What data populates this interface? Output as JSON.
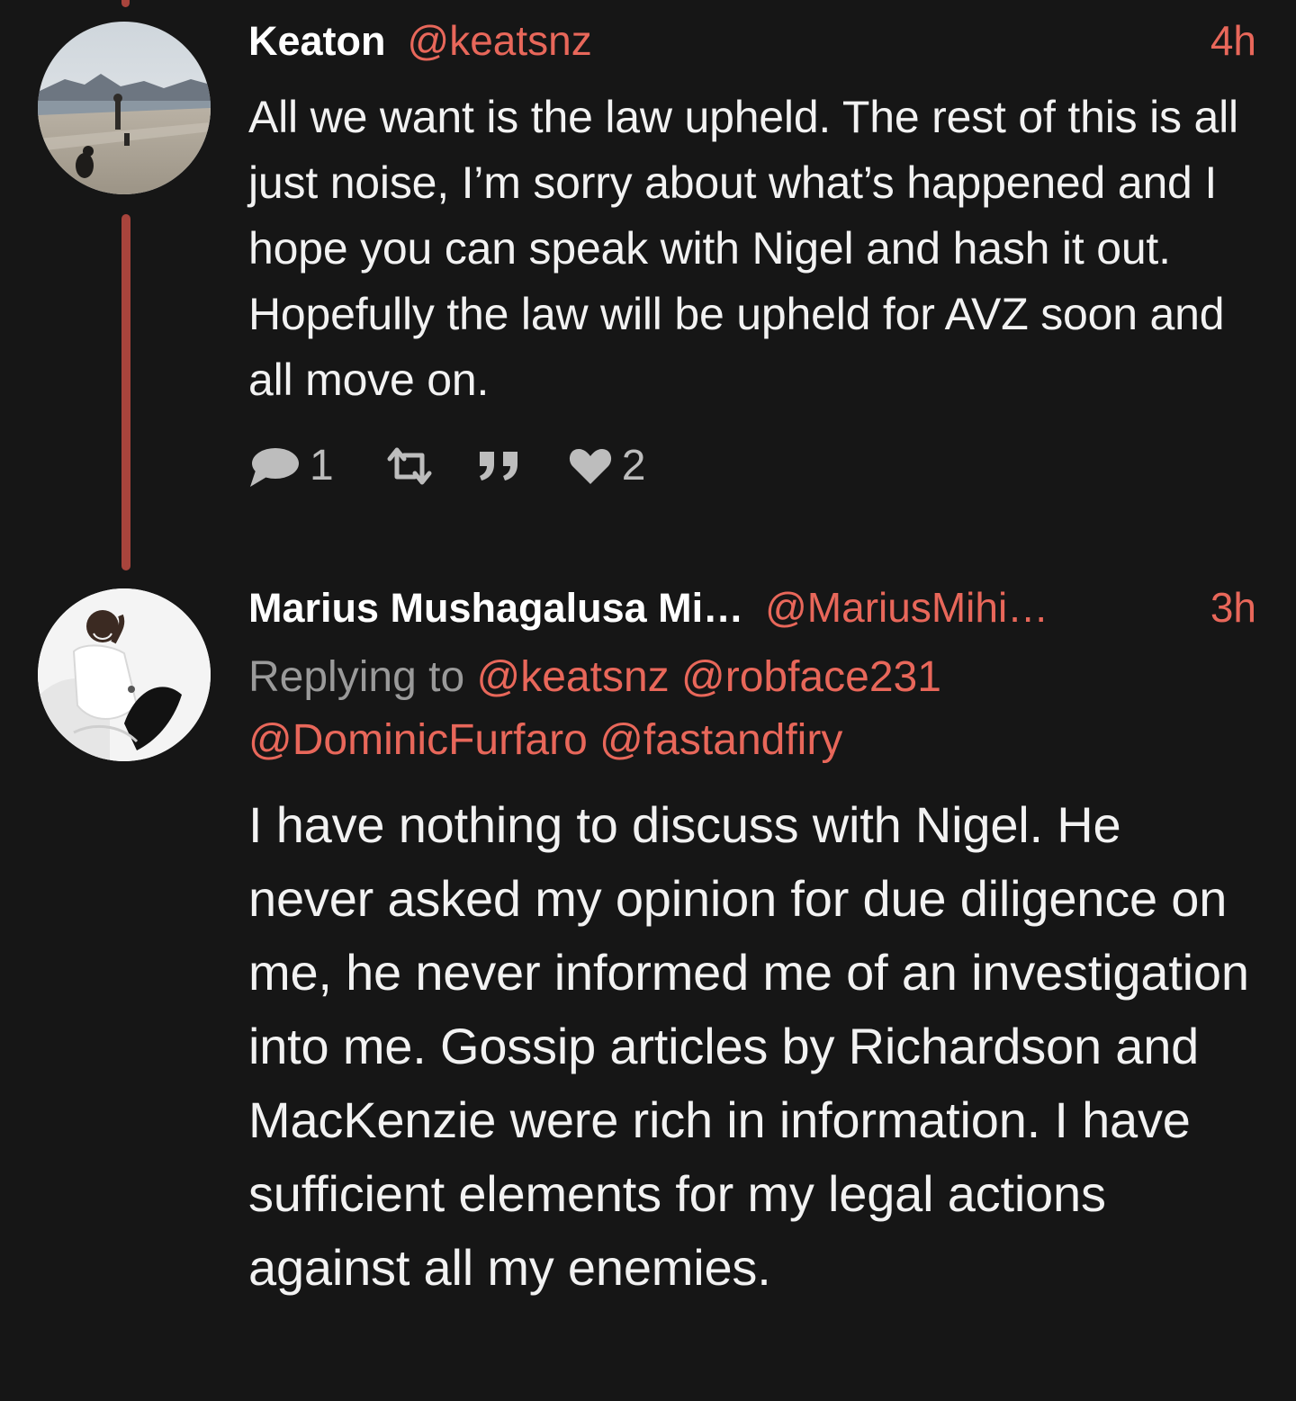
{
  "tweets": [
    {
      "display_name": "Keaton",
      "handle": "@keatsnz",
      "time": "4h",
      "text": "All we want is the law upheld. The rest of this is all just noise, I’m sorry about what’s happened and I hope you can speak with Nigel and hash it out. Hopefully the law will be upheld for AVZ soon and all move on.",
      "actions": {
        "reply_icon": "reply-icon",
        "reply_count": "1",
        "retweet_icon": "retweet-icon",
        "quote_icon": "quote-icon",
        "like_icon": "heart-icon",
        "like_count": "2"
      }
    },
    {
      "display_name": "Marius Mushagalusa Mi…",
      "handle": "@MariusMihi…",
      "time": "3h",
      "replying_label": "Replying to",
      "replying_to": [
        "@keatsnz",
        "@robface231",
        "@DominicFurfaro",
        "@fastandfiry"
      ],
      "text": "I have nothing to discuss with Nigel. He never asked my opinion for due diligence on me, he never informed me of an investigation into me. Gossip articles by Richardson and MacKenzie were rich in information. I have sufficient elements for my legal actions against all my enemies."
    }
  ],
  "colors": {
    "background": "#161616",
    "accent": "#e8675a",
    "thread_line": "#a8443c",
    "muted": "#9a9a9a"
  }
}
